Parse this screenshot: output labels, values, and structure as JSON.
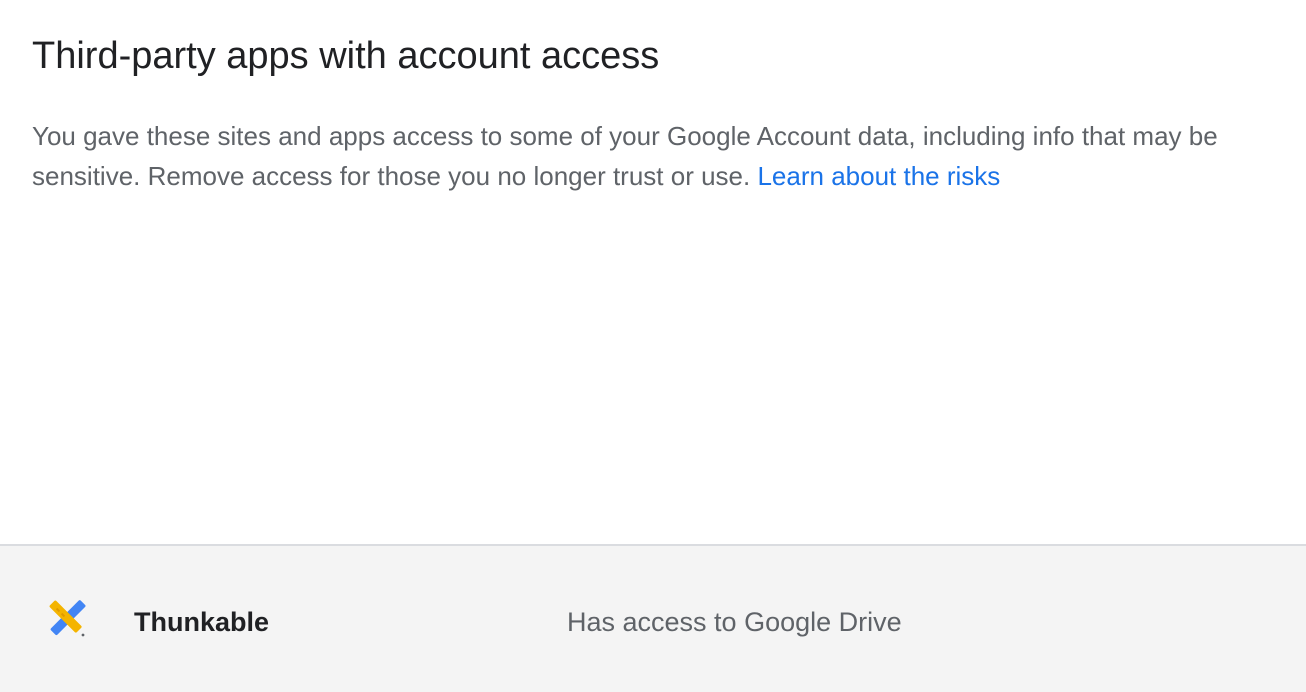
{
  "header": {
    "title": "Third-party apps with account access"
  },
  "description": {
    "text": "You gave these sites and apps access to some of your Google Account data, including info that may be sensitive. Remove access for those you no longer trust or use. ",
    "link_label": "Learn about the risks"
  },
  "apps": [
    {
      "name": "Thunkable",
      "access": "Has access to Google Drive",
      "icon": "thunkable-logo-icon"
    }
  ],
  "colors": {
    "link": "#1a73e8",
    "row_background": "#f4f4f4",
    "divider": "#dadce0",
    "icon_blue": "#4285f4",
    "icon_yellow": "#f4b400"
  }
}
